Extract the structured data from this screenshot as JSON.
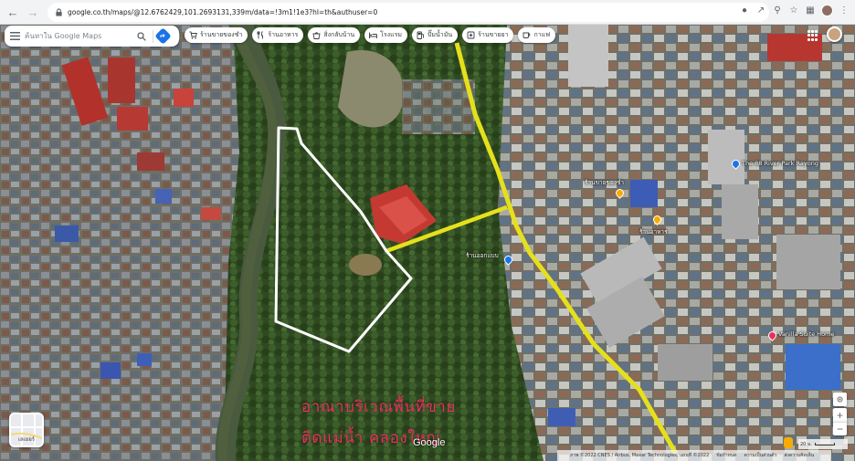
{
  "browser": {
    "url": "google.co.th/maps/@12.6762429,101.2693131,339m/data=!3m1!1e3?hl=th&authuser=0",
    "nav_icons": [
      "back-icon",
      "forward-icon",
      "reload-icon"
    ],
    "toolbar_icons": [
      "location-icon",
      "share-icon",
      "zoom-icon",
      "star-icon",
      "extension-icon"
    ]
  },
  "search": {
    "placeholder": "ค้นหาใน Google Maps",
    "icons": [
      "menu-icon",
      "search-icon",
      "directions-icon"
    ]
  },
  "chips": [
    {
      "label": "ร้านขายของชำ",
      "icon": "cart-icon"
    },
    {
      "label": "ร้านอาหาร",
      "icon": "restaurant-icon"
    },
    {
      "label": "สิ่งกลับบ้าน",
      "icon": "takeout-icon"
    },
    {
      "label": "โรงแรม",
      "icon": "hotel-icon"
    },
    {
      "label": "ปั๊มน้ำมัน",
      "icon": "gas-icon"
    },
    {
      "label": "ร้านขายยา",
      "icon": "pharmacy-icon"
    },
    {
      "label": "กาแฟ",
      "icon": "coffee-icon"
    }
  ],
  "annotation": {
    "line1": "อาณาบริเวณพื้นที่ขาย",
    "line2": "ติดแม่น้ำ คลองใหญ่"
  },
  "places": [
    {
      "label": "The 88 River Park Rayong",
      "pin_color": "#1a73e8"
    },
    {
      "label": "Vanilla Suite Home",
      "pin_color": "#e8305e"
    },
    {
      "label": "ร้านขายของชำ",
      "pin_color": "#f9ab00"
    },
    {
      "label": "ร้านอาหาร",
      "pin_color": "#f9ab00"
    },
    {
      "label": "ร้านออกแบบ",
      "pin_color": "#1a73e8"
    }
  ],
  "map_controls": {
    "layers_label": "เลเยอร์",
    "zoom_in": "+",
    "zoom_out": "−",
    "google_logo": "Google"
  },
  "footer": {
    "attribution": "ภาพ ©2022 CNES / Airbus, Maxar Technologies, แผนที่ ©2022",
    "terms": "ข้อกำหนด",
    "privacy": "ความเป็นส่วนตัว",
    "feedback": "ส่งความคิดเห็น",
    "scale_label": "20 ม."
  },
  "colors": {
    "road_yellow": "#e6e01c",
    "plot_outline": "#ffffff",
    "annotation_text": "#e8305e",
    "google_blue": "#1a73e8"
  }
}
